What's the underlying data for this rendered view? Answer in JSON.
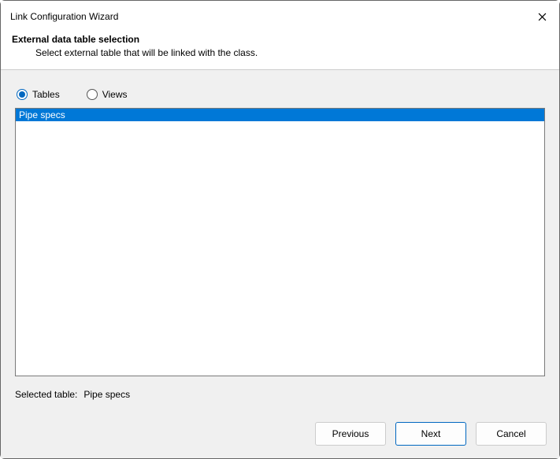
{
  "titlebar": {
    "title": "Link Configuration Wizard"
  },
  "header": {
    "title": "External data table selection",
    "subtitle": "Select external table that will be linked with the class."
  },
  "radios": {
    "tables": "Tables",
    "views": "Views",
    "selected": "tables"
  },
  "list": {
    "items": [
      "Pipe specs"
    ],
    "selected_index": 0
  },
  "selected": {
    "label": "Selected table:",
    "value": "Pipe specs"
  },
  "footer": {
    "previous": "Previous",
    "next": "Next",
    "cancel": "Cancel"
  }
}
